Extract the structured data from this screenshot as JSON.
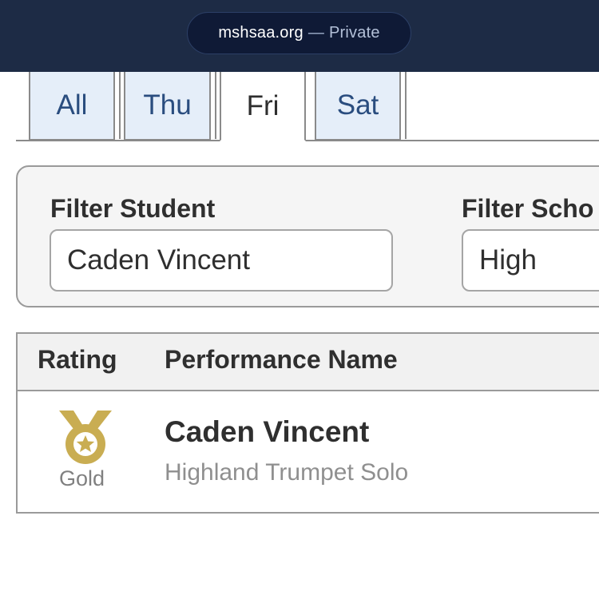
{
  "browser": {
    "domain": "mshsaa.org",
    "separator": "—",
    "mode": "Private"
  },
  "tabs": [
    {
      "label": "All",
      "active": false
    },
    {
      "label": "Thu",
      "active": false
    },
    {
      "label": "Fri",
      "active": true
    },
    {
      "label": "Sat",
      "active": false
    }
  ],
  "filters": {
    "student": {
      "label": "Filter Student",
      "value": "Caden Vincent"
    },
    "school": {
      "label": "Filter Scho",
      "value": "High"
    }
  },
  "table": {
    "headers": {
      "rating": "Rating",
      "performance": "Performance Name"
    },
    "rows": [
      {
        "rating": "Gold",
        "rating_icon": "gold-medal-icon",
        "name": "Caden Vincent",
        "performance": "Highland Trumpet Solo"
      }
    ]
  },
  "colors": {
    "header_bg": "#1d2b45",
    "tab_inactive_bg": "#e5eef9",
    "tab_text": "#2a4d7f",
    "medal_gold": "#c9ad52"
  }
}
